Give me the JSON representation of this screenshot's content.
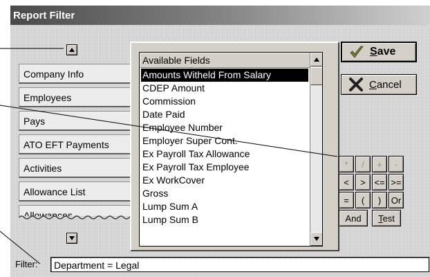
{
  "window": {
    "title": "Report Filter"
  },
  "tabs": [
    "Company Info",
    "Employees",
    "Pays",
    "ATO EFT Payments",
    "Activities",
    "Allowance List",
    "Allowances"
  ],
  "field_list": {
    "header": "Available Fields",
    "selected_index": 0,
    "items": [
      "Amounts Witheld From Salary",
      "CDEP Amount",
      "Commission",
      "Date Paid",
      "Employee Number",
      "Employer Super Cont.",
      "Ex Payroll Tax Allowance",
      "Ex Payroll Tax Employee",
      "Ex WorkCover",
      "Gross",
      "Lump Sum A",
      "Lump Sum B"
    ]
  },
  "buttons": {
    "save_underline": "S",
    "save_rest": "ave",
    "cancel_underline": "C",
    "cancel_rest": "ancel"
  },
  "operators": {
    "row1": [
      "*",
      "/",
      "+",
      "-"
    ],
    "row2": [
      "<",
      ">",
      "<=",
      ">="
    ],
    "row3": [
      "=",
      "(",
      ")",
      "Or"
    ],
    "and_label": "And",
    "test_underline": "T",
    "test_rest": "est"
  },
  "filter": {
    "label": "Filter:",
    "value": "Department = Legal"
  },
  "colors": {
    "title_dark": "#4a4a4a",
    "selection": "#000000",
    "save_check": "#7a7a3a"
  },
  "icons": {
    "save": "check-icon",
    "cancel": "x-icon",
    "scroll_up": "triangle-up-icon",
    "scroll_down": "triangle-down-icon"
  }
}
